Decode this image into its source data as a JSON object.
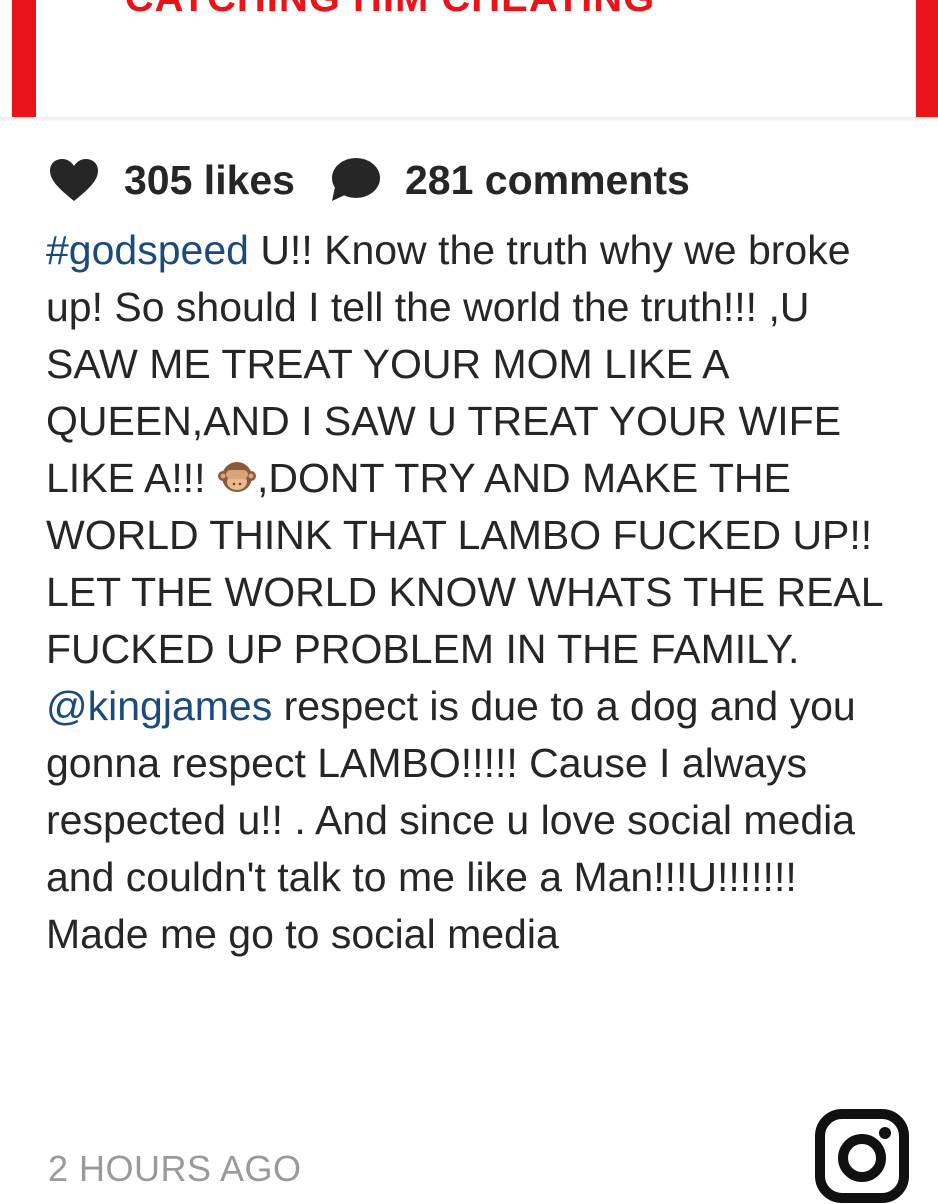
{
  "banner": {
    "text": "CATCHING HIM CHEATING"
  },
  "stats": {
    "likes": "305 likes",
    "comments": "281 comments"
  },
  "caption": {
    "hashtag": "#godspeed",
    "part1": " U!! Know the truth why we broke up! So should I tell the world the truth!!! ,U SAW ME TREAT YOUR MOM LIKE A QUEEN,AND I SAW U TREAT YOUR WIFE LIKE A!!!",
    "emoji": "see-no-evil-monkey",
    "part2": ",DONT TRY AND MAKE THE WORLD THINK THAT LAMBO FUCKED UP!! LET THE WORLD KNOW WHATS THE REAL FUCKED UP PROBLEM IN THE FAMILY.",
    "mention": "@kingjames",
    "part3": " respect is due to a dog and you gonna respect LAMBO!!!!! Cause I always respected u!! . And since u love social media and couldn't talk to me like a Man!!!U!!!!!!! Made me go to social media"
  },
  "timestamp": "2 HOURS AGO",
  "colors": {
    "accent_red": "#e8141a",
    "link_blue": "#1b4a7c",
    "text": "#262626",
    "muted": "#9a9a9a"
  }
}
